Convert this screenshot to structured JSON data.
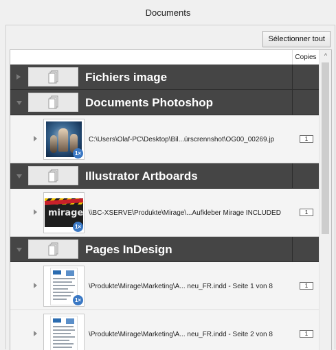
{
  "window": {
    "title": "Documents"
  },
  "toolbar": {
    "select_all_label": "Sélectionner tout"
  },
  "columns": {
    "copies": "Copies"
  },
  "groups": [
    {
      "title": "Fichiers image",
      "expanded": false,
      "items": []
    },
    {
      "title": "Documents Photoshop",
      "expanded": true,
      "items": [
        {
          "path": "C:\\Users\\Olaf-PC\\Desktop\\Bil...ürscrennshot\\OG00_00269.jp",
          "copies": "1",
          "badge": "1×",
          "thumb": "photo"
        }
      ]
    },
    {
      "title": "Illustrator Artboards",
      "expanded": true,
      "items": [
        {
          "path": "\\\\BC-XSERVE\\Produkte\\Mirage\\...Aufkleber Mirage INCLUDED",
          "copies": "1",
          "badge": "1×",
          "thumb": "mirage",
          "thumb_text": "mirage"
        }
      ]
    },
    {
      "title": "Pages InDesign",
      "expanded": true,
      "items": [
        {
          "path": "\\Produkte\\Mirage\\Marketing\\A... neu_FR.indd - Seite 1 von 8",
          "copies": "1",
          "badge": "1×",
          "thumb": "page"
        },
        {
          "path": "\\Produkte\\Mirage\\Marketing\\A... neu_FR.indd - Seite 2 von 8",
          "copies": "1",
          "badge": "",
          "thumb": "page"
        }
      ]
    }
  ],
  "colors": {
    "group_bg": "#454545",
    "group_text": "#ffffff",
    "badge": "#3a78c4",
    "row_bg": "#f4f4f4"
  },
  "icons": {
    "collapsed": "triangle-right-icon",
    "expanded": "triangle-down-icon",
    "group": "document-stack-icon",
    "scroll_up": "chevron-up-icon"
  }
}
